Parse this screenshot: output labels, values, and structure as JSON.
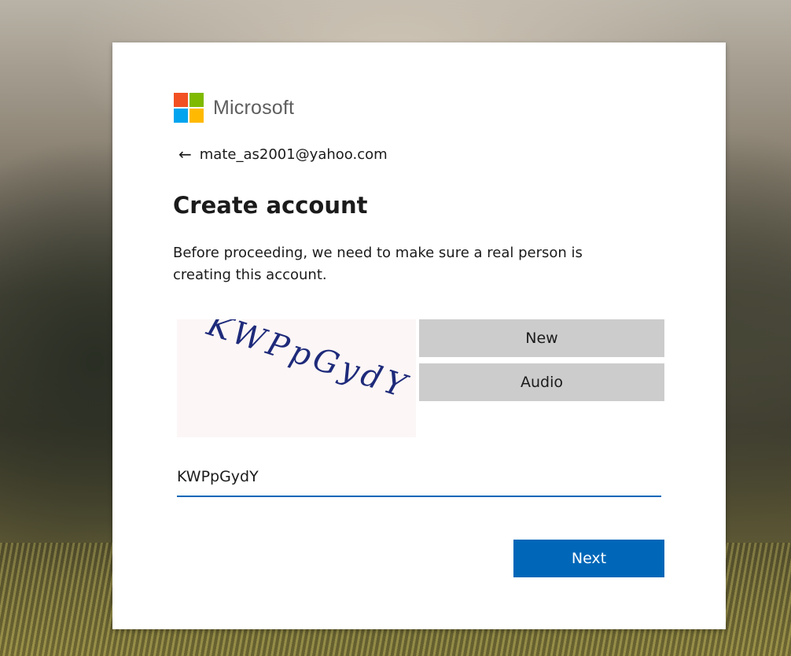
{
  "brand": {
    "name": "Microsoft",
    "logo_colors": [
      "#f25022",
      "#7fba00",
      "#00a4ef",
      "#ffb900"
    ]
  },
  "identity": {
    "email": "mate_as2001@yahoo.com",
    "back_icon": "left-arrow-icon"
  },
  "title": "Create account",
  "description": "Before proceeding, we need to make sure a real person is creating this account.",
  "captcha": {
    "image_text": "KWPpGydY",
    "new_label": "New",
    "audio_label": "Audio",
    "input_value": "KWPpGydY"
  },
  "actions": {
    "next_label": "Next"
  },
  "colors": {
    "accent": "#0067b8",
    "secondary_button": "#cccccc",
    "captcha_ink": "#1e2a7a"
  }
}
